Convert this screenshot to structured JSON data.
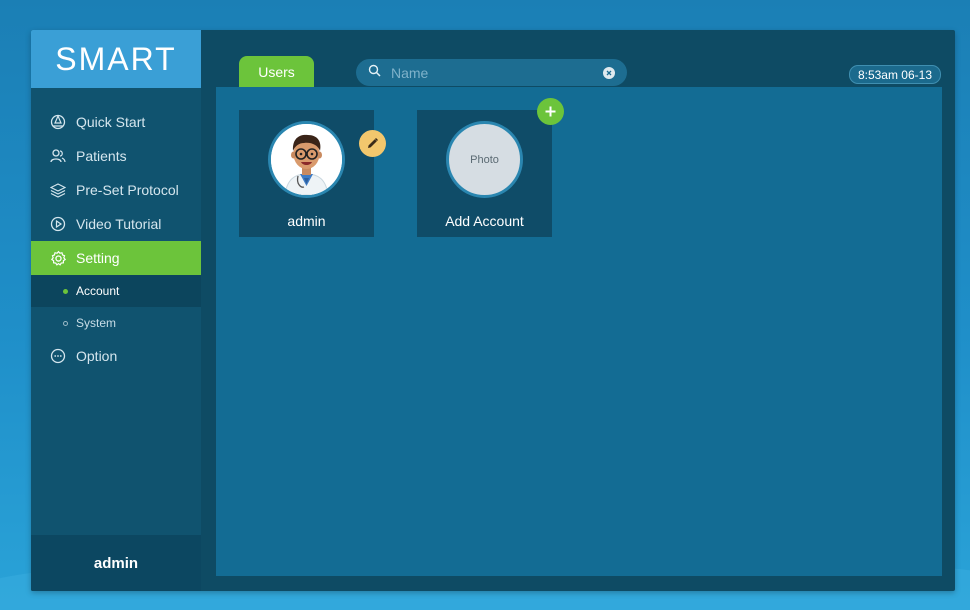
{
  "app": {
    "logo": "SMART"
  },
  "sidebar": {
    "items": [
      {
        "label": "Quick Start",
        "icon": "quick-start-icon"
      },
      {
        "label": "Patients",
        "icon": "patients-icon"
      },
      {
        "label": "Pre-Set Protocol",
        "icon": "layers-icon"
      },
      {
        "label": "Video Tutorial",
        "icon": "play-circle-icon"
      },
      {
        "label": "Setting",
        "icon": "gear-icon",
        "active": true
      },
      {
        "label": "Option",
        "icon": "more-circle-icon"
      }
    ],
    "subitems": [
      {
        "label": "Account",
        "active": true
      },
      {
        "label": "System"
      }
    ],
    "user": "admin"
  },
  "header": {
    "tab": "Users",
    "search": {
      "placeholder": "Name",
      "value": ""
    },
    "time": "8:53am 06-13"
  },
  "users": [
    {
      "name": "admin"
    },
    {
      "name": "Add Account",
      "photo_label": "Photo"
    }
  ],
  "colors": {
    "accent": "#6cc43b",
    "sidebar": "#10536f",
    "panel": "#136c94",
    "logo_bg": "#3a9fd6",
    "edit": "#f2c76d"
  }
}
